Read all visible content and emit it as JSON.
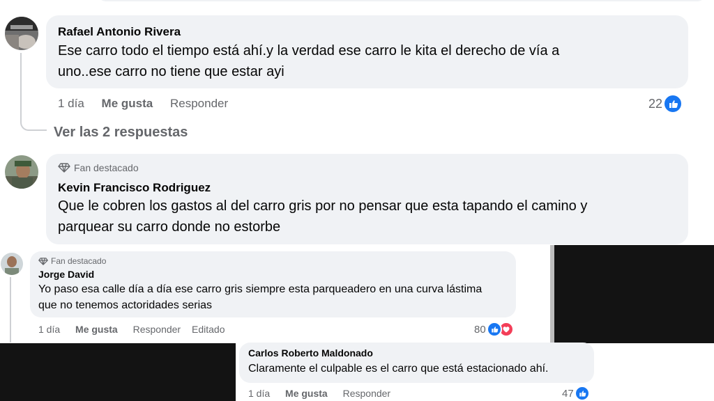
{
  "colors": {
    "bubble": "#f0f2f5",
    "meta_text": "#65676b",
    "like_blue": "#1877f2",
    "love_red": "#f33e58",
    "dark_panel": "#131313"
  },
  "comment1": {
    "author": "Rafael Antonio Rivera",
    "line1": "Ese carro todo el tiempo está ahí.y la verdad ese carro le kita el derecho de vía a",
    "line2": "uno..ese carro no tiene que estar ayi",
    "time": "1 día",
    "like": "Me gusta",
    "reply": "Responder",
    "reactions": "22",
    "reaction_icons": [
      "like-icon"
    ]
  },
  "replies_link": "Ver las 2 respuestas",
  "comment2": {
    "badge": "Fan destacado",
    "badge_icon": "diamond-icon",
    "author": "Kevin Francisco Rodriguez",
    "line1": "Que le cobren los gastos al del carro gris por no pensar que esta tapando el camino y",
    "line2": "parquear su carro donde no estorbe"
  },
  "comment3": {
    "badge": "Fan destacado",
    "badge_icon": "diamond-icon",
    "author": "Jorge David",
    "line1": "Yo paso esa calle día a día ese carro gris siempre esta parqueadero en una curva lástima",
    "line2": "que no tenemos actoridades serias",
    "time": "1 día",
    "like": "Me gusta",
    "reply": "Responder",
    "edited": "Editado",
    "reactions": "80",
    "reaction_icons": [
      "like-icon",
      "love-icon"
    ]
  },
  "comment4": {
    "author": "Carlos Roberto Maldonado",
    "line1": "Claramente el culpable es el carro que está estacionado ahí.",
    "time": "1 día",
    "like": "Me gusta",
    "reply": "Responder",
    "reactions": "47",
    "reaction_icons": [
      "like-icon"
    ]
  }
}
